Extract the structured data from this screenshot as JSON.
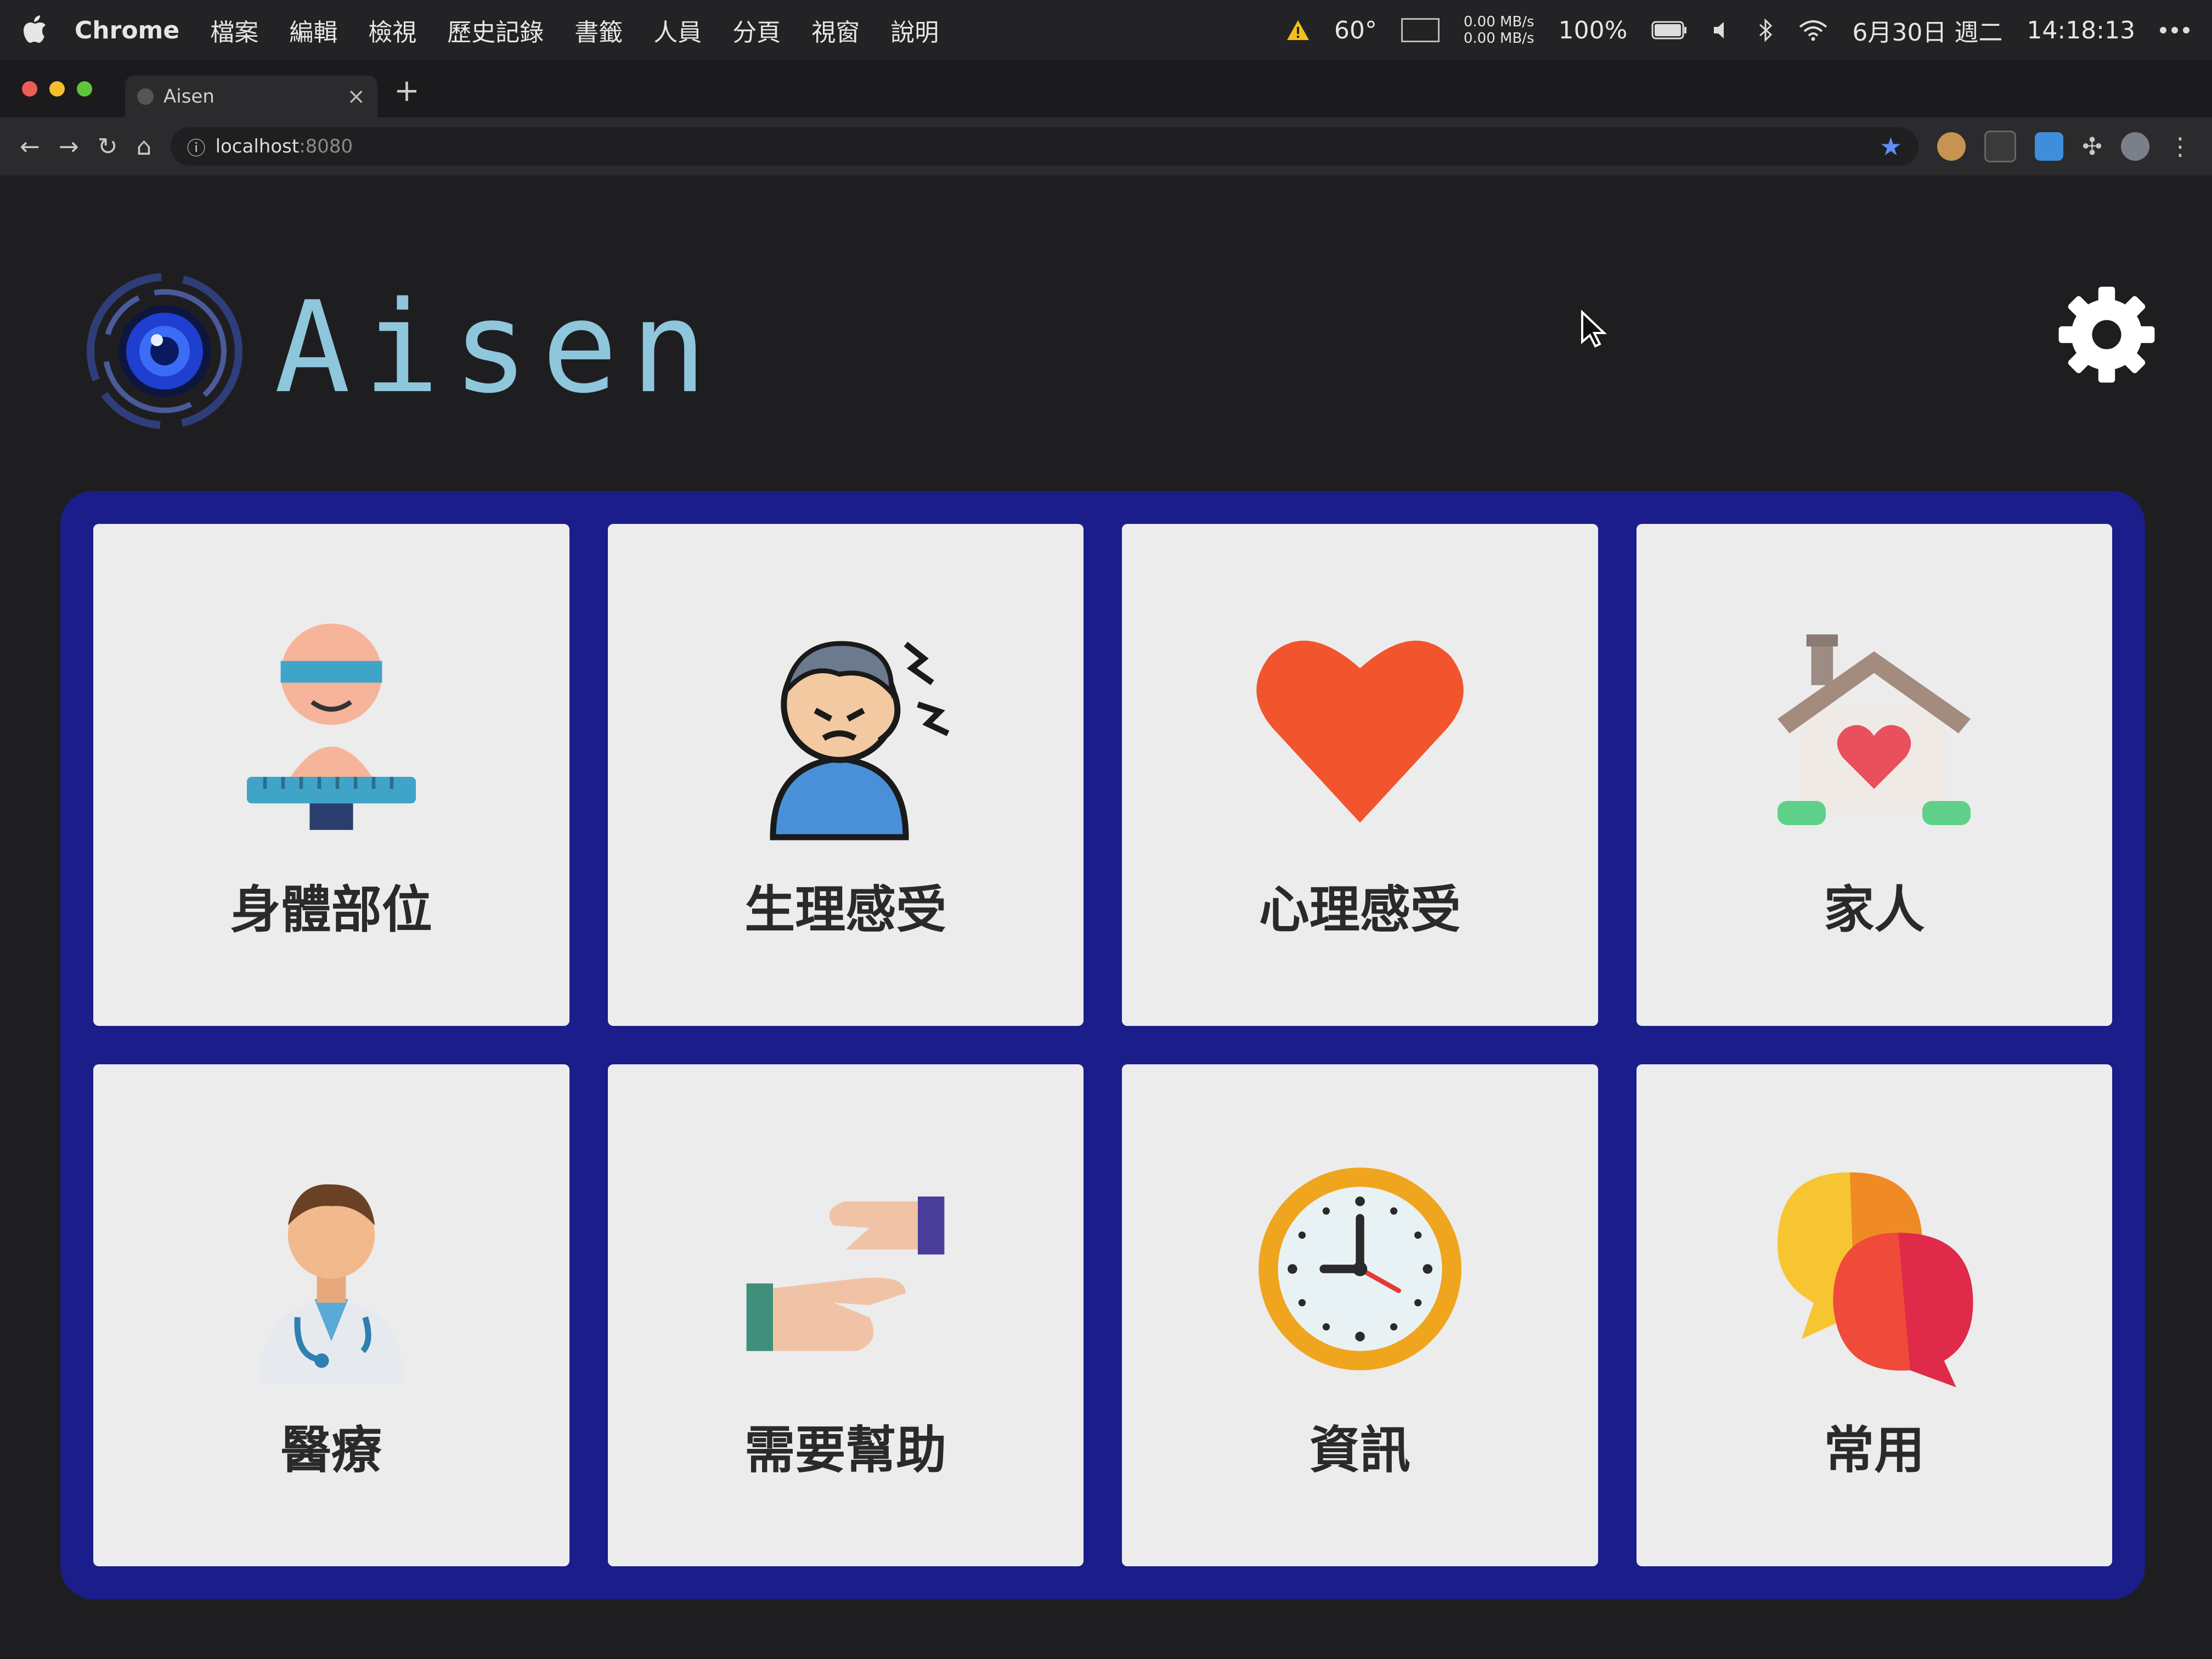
{
  "menubar": {
    "items": [
      "Chrome",
      "檔案",
      "編輯",
      "檢視",
      "歷史記錄",
      "書籤",
      "人員",
      "分頁",
      "視窗",
      "說明"
    ],
    "temperature": "60°",
    "net_up": "0.00 MB/s",
    "net_down": "0.00 MB/s",
    "battery": "100%",
    "date": "6月30日 週二",
    "time": "14:18:13"
  },
  "browser": {
    "tab_title": "Aisen",
    "url_host": "localhost",
    "url_port": ":8080"
  },
  "app": {
    "title": "Aisen",
    "accent": "#8ec6dc",
    "panel_color": "#1b1d8a",
    "tiles": [
      {
        "label": "身體部位",
        "icon": "body-measure-icon"
      },
      {
        "label": "生理感受",
        "icon": "headache-person-icon"
      },
      {
        "label": "心理感受",
        "icon": "heart-icon"
      },
      {
        "label": "家人",
        "icon": "house-heart-icon"
      },
      {
        "label": "醫療",
        "icon": "doctor-icon"
      },
      {
        "label": "需要幫助",
        "icon": "helping-hands-icon"
      },
      {
        "label": "資訊",
        "icon": "clock-icon"
      },
      {
        "label": "常用",
        "icon": "chat-bubbles-icon"
      }
    ]
  }
}
